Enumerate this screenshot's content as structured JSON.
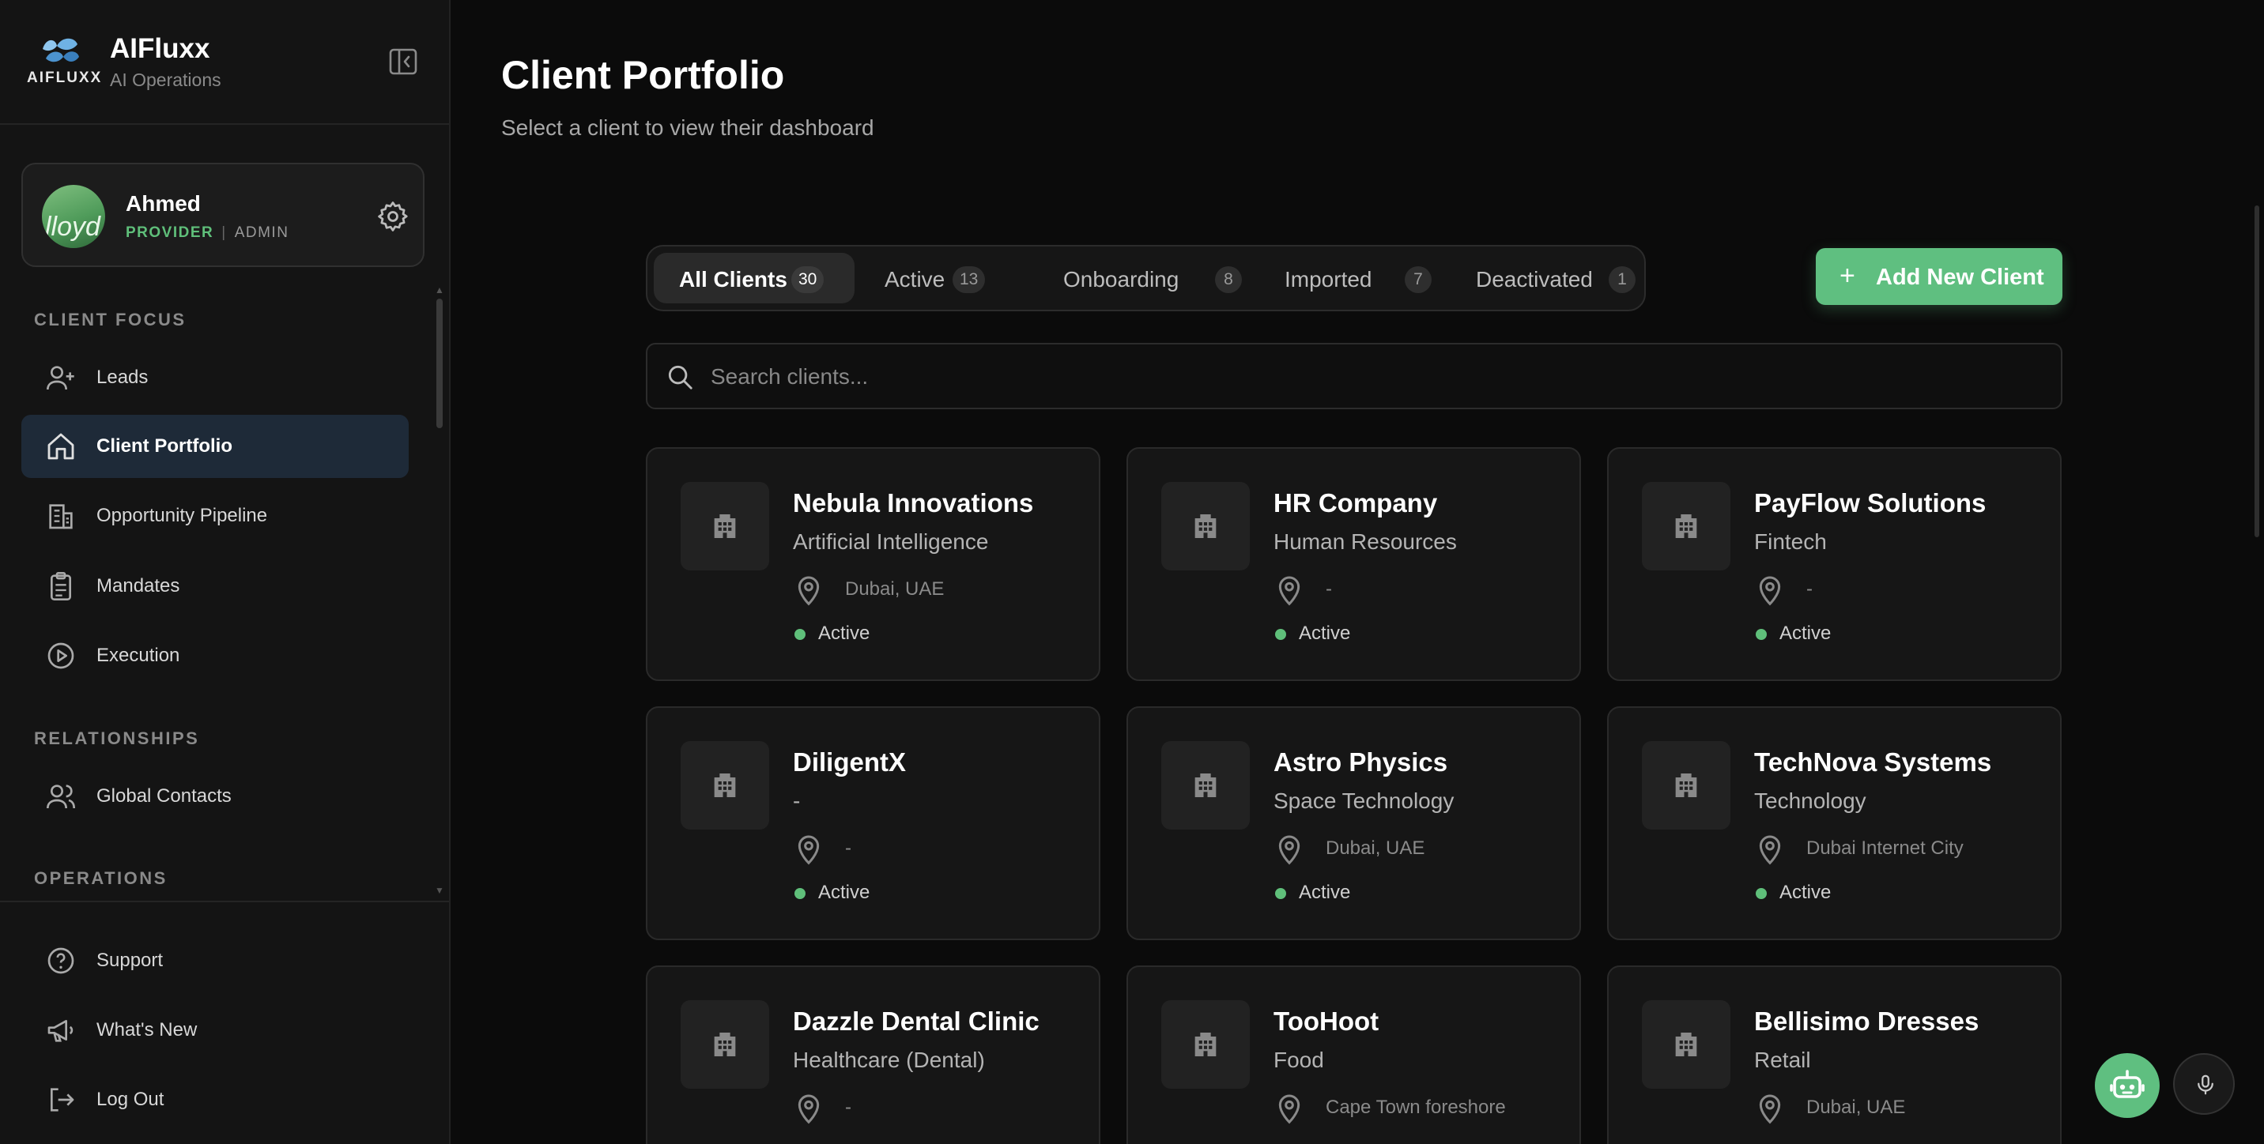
{
  "brand": {
    "logo_text": "AIFLUXX",
    "name": "AIFluxx",
    "subtitle": "AI Operations"
  },
  "profile": {
    "avatar_text": "lloyd",
    "name": "Ahmed",
    "role_primary": "PROVIDER",
    "role_separator": "|",
    "role_secondary": "ADMIN"
  },
  "sidebar": {
    "section_client_focus": "CLIENT FOCUS",
    "section_relationships": "RELATIONSHIPS",
    "section_operations": "OPERATIONS",
    "items": [
      {
        "label": "Leads",
        "icon": "user-plus-icon"
      },
      {
        "label": "Client Portfolio",
        "icon": "home-icon",
        "active": true
      },
      {
        "label": "Opportunity Pipeline",
        "icon": "building-chart-icon"
      },
      {
        "label": "Mandates",
        "icon": "clipboard-icon"
      },
      {
        "label": "Execution",
        "icon": "play-circle-icon"
      },
      {
        "label": "Global Contacts",
        "icon": "users-icon"
      }
    ],
    "bottom": [
      {
        "label": "Support",
        "icon": "help-circle-icon"
      },
      {
        "label": "What's New",
        "icon": "megaphone-icon"
      },
      {
        "label": "Log Out",
        "icon": "logout-icon"
      }
    ]
  },
  "main": {
    "title": "Client Portfolio",
    "subtitle": "Select a client to view their dashboard",
    "tabs": [
      {
        "label": "All Clients",
        "count": "30",
        "active": true
      },
      {
        "label": "Active",
        "count": "13"
      },
      {
        "label": "Onboarding",
        "count": "8"
      },
      {
        "label": "Imported",
        "count": "7"
      },
      {
        "label": "Deactivated",
        "count": "1"
      }
    ],
    "add_button": "Add New Client",
    "add_icon": "+",
    "search_placeholder": "Search clients...",
    "clients": [
      {
        "name": "Nebula Innovations",
        "industry": "Artificial Intelligence",
        "location": "Dubai, UAE",
        "status": "Active"
      },
      {
        "name": "HR Company",
        "industry": "Human Resources",
        "location": "-",
        "status": "Active"
      },
      {
        "name": "PayFlow Solutions",
        "industry": "Fintech",
        "location": "-",
        "status": "Active"
      },
      {
        "name": "DiligentX",
        "industry": "-",
        "location": "-",
        "status": "Active"
      },
      {
        "name": "Astro Physics",
        "industry": "Space Technology",
        "location": "Dubai, UAE",
        "status": "Active"
      },
      {
        "name": "TechNova Systems",
        "industry": "Technology",
        "location": "Dubai Internet City",
        "status": "Active"
      },
      {
        "name": "Dazzle Dental Clinic",
        "industry": "Healthcare (Dental)",
        "location": "-",
        "status": ""
      },
      {
        "name": "TooHoot",
        "industry": "Food",
        "location": "Cape Town foreshore",
        "status": ""
      },
      {
        "name": "Bellisimo Dresses",
        "industry": "Retail",
        "location": "Dubai, UAE",
        "status": ""
      }
    ]
  },
  "colors": {
    "accent": "#5fbf80",
    "status_active": "#5fbf7a",
    "nav_active_bg": "#1e2a38",
    "background": "#0b0b0b"
  }
}
